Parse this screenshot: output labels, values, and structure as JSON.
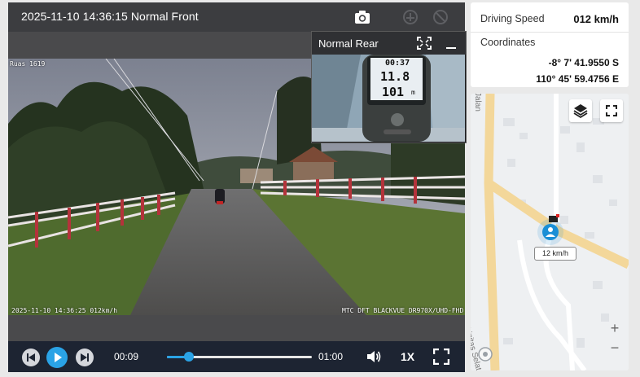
{
  "player": {
    "title": "2025-11-10 14:36:15 Normal Front",
    "topbar_icons": [
      "camera-icon",
      "download-icon",
      "share-icon"
    ]
  },
  "video": {
    "osd_top_left": "Ruas 1619",
    "osd_bottom_left": "2025-11-10 14:36:25 012km/h",
    "osd_bottom_right": "MTC DFT BLACKVUE DR970X/UHD-FHD"
  },
  "pip": {
    "label": "Normal Rear",
    "device_readout": {
      "time": "00:37",
      "speed": "11.8",
      "altitude": "101",
      "unit": "m"
    }
  },
  "controls": {
    "current_time": "00:09",
    "total_time": "01:00",
    "progress_fraction": 0.15,
    "playback_speed": "1X",
    "icons": [
      "prev-icon",
      "play-icon",
      "next-icon",
      "volume-icon",
      "fullscreen-icon"
    ]
  },
  "info": {
    "speed_label": "Driving Speed",
    "speed_value": "012 km/h",
    "coords_label": "Coordinates",
    "lat": "-8° 7' 41.9550 S",
    "lon": "110° 45' 59.4756 E"
  },
  "map": {
    "speed_tag": "12 km/h",
    "road_name": "Jalan Linitas Selatan",
    "road_name_top": "Jalan",
    "zoom_in": "+",
    "zoom_out": "−",
    "colors": {
      "road_yellow": "#f3d79a",
      "road_white": "#ffffff",
      "marker_blue": "#1a8fd6"
    }
  }
}
